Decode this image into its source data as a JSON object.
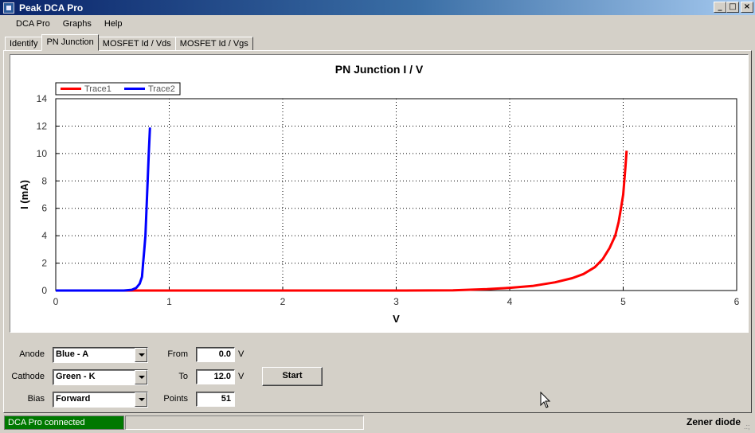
{
  "window": {
    "title": "Peak DCA Pro",
    "buttons": [
      "_",
      "□",
      "×"
    ]
  },
  "menu": {
    "items": [
      "DCA Pro",
      "Graphs",
      "Help"
    ]
  },
  "tabs": [
    {
      "label": "Identify",
      "active": false
    },
    {
      "label": "PN Junction",
      "active": true
    },
    {
      "label": "MOSFET Id / Vds",
      "active": false
    },
    {
      "label": "MOSFET Id / Vgs",
      "active": false
    }
  ],
  "chart_data": {
    "type": "line",
    "title": "PN Junction I / V",
    "xlabel": "V",
    "ylabel": "I (mA)",
    "xlim": [
      0,
      6
    ],
    "ylim": [
      0,
      14
    ],
    "x_ticks": [
      "0",
      "1",
      "2",
      "3",
      "4",
      "5",
      "6"
    ],
    "y_ticks": [
      "0",
      "2",
      "4",
      "6",
      "8",
      "10",
      "12",
      "14"
    ],
    "grid": true,
    "legend_position": "top-left",
    "series": [
      {
        "name": "Trace1",
        "color": "#ff0000",
        "points": [
          [
            0,
            0
          ],
          [
            1,
            0
          ],
          [
            2,
            0
          ],
          [
            3,
            0
          ],
          [
            3.5,
            0.02
          ],
          [
            3.8,
            0.1
          ],
          [
            4.0,
            0.2
          ],
          [
            4.2,
            0.33
          ],
          [
            4.4,
            0.6
          ],
          [
            4.55,
            0.9
          ],
          [
            4.65,
            1.2
          ],
          [
            4.75,
            1.7
          ],
          [
            4.82,
            2.3
          ],
          [
            4.88,
            3.1
          ],
          [
            4.93,
            4.0
          ],
          [
            4.96,
            5.0
          ],
          [
            4.98,
            6.0
          ],
          [
            5.0,
            7.0
          ],
          [
            5.01,
            8.0
          ],
          [
            5.02,
            9.0
          ],
          [
            5.03,
            10.2
          ]
        ]
      },
      {
        "name": "Trace2",
        "color": "#0000ff",
        "points": [
          [
            0,
            0
          ],
          [
            0.6,
            0
          ],
          [
            0.67,
            0.05
          ],
          [
            0.71,
            0.2
          ],
          [
            0.74,
            0.5
          ],
          [
            0.76,
            1.0
          ],
          [
            0.77,
            2.0
          ],
          [
            0.78,
            3.0
          ],
          [
            0.79,
            4.0
          ],
          [
            0.795,
            5.0
          ],
          [
            0.8,
            6.0
          ],
          [
            0.805,
            7.0
          ],
          [
            0.81,
            8.0
          ],
          [
            0.815,
            9.0
          ],
          [
            0.82,
            10.0
          ],
          [
            0.825,
            11.0
          ],
          [
            0.83,
            11.9
          ]
        ]
      }
    ]
  },
  "controls": {
    "anode": {
      "label": "Anode",
      "value": "Blue - A"
    },
    "cathode": {
      "label": "Cathode",
      "value": "Green - K"
    },
    "bias": {
      "label": "Bias",
      "value": "Forward"
    },
    "from": {
      "label": "From",
      "value": "0.0",
      "unit": "V"
    },
    "to": {
      "label": "To",
      "value": "12.0",
      "unit": "V"
    },
    "points": {
      "label": "Points",
      "value": "51"
    },
    "start_label": "Start"
  },
  "status": {
    "connection": "DCA Pro connected",
    "component": "Zener diode",
    "grip": ".:;"
  }
}
